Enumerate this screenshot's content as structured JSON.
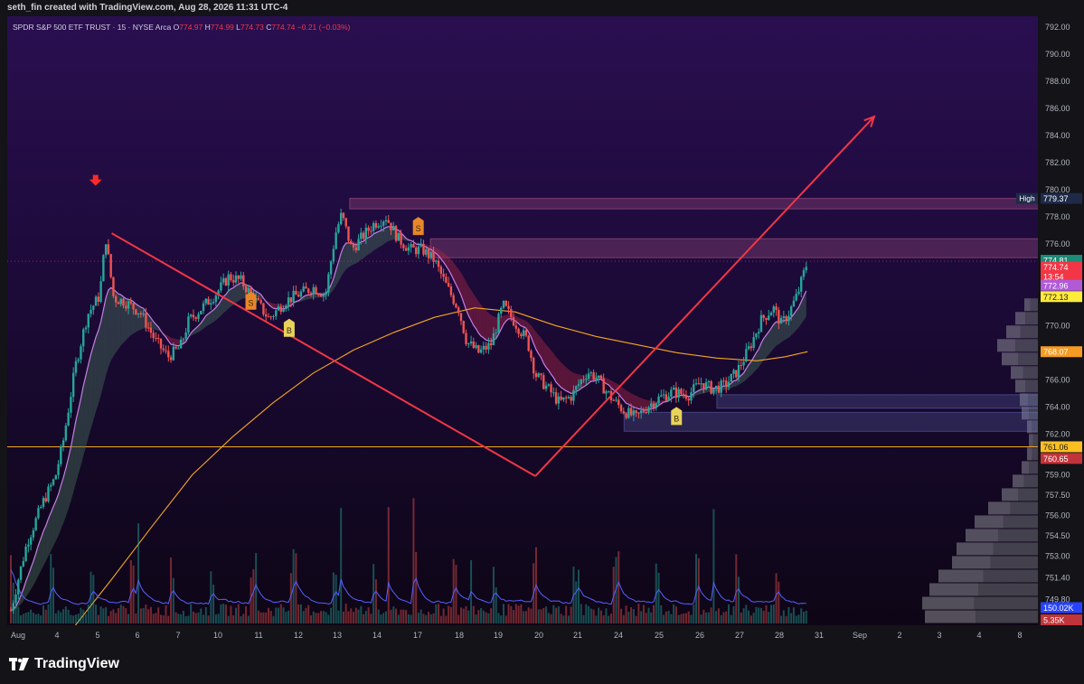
{
  "header": {
    "credit": "seth_fin created with TradingView.com, Aug 28, 2026 11:31 UTC-4"
  },
  "legend": {
    "symbol": "SPDR S&P 500 ETF TRUST · 15 · NYSE Arca",
    "o_label": "O",
    "o_value": "774.97",
    "h_label": "H",
    "h_value": "774.99",
    "l_label": "L",
    "l_value": "774.73",
    "c_label": "C",
    "c_value": "774.74",
    "change": "−0.21 (−0.03%)"
  },
  "footer": {
    "brand": "TradingView"
  },
  "colors": {
    "up": "#26a69a",
    "down": "#ef5350",
    "arrow": "#f23645",
    "ma_slow": "#f5a623",
    "ma_fast": "#c67ee6",
    "volume_ma": "#5560ff",
    "background": "#131318"
  },
  "chart_data": {
    "type": "candlestick",
    "interval": "15",
    "y_axis": {
      "range": [
        747.9,
        792.8
      ],
      "ticks": [
        "792.00",
        "790.00",
        "788.00",
        "786.00",
        "784.00",
        "782.00",
        "780.00",
        "778.00",
        "776.00",
        "770.00",
        "766.00",
        "764.00",
        "762.00",
        "759.00",
        "757.50",
        "756.00",
        "754.50",
        "753.00",
        "751.40",
        "749.80"
      ]
    },
    "x_axis": {
      "ticks": [
        "Aug",
        "4",
        "5",
        "6",
        "7",
        "10",
        "11",
        "12",
        "13",
        "14",
        "17",
        "18",
        "19",
        "20",
        "21",
        "24",
        "25",
        "26",
        "27",
        "28",
        "31",
        "Sep",
        "2",
        "3",
        "4",
        "8"
      ]
    },
    "price_labels": [
      {
        "text": "High",
        "value": "779.37",
        "price": 779.37,
        "color": "#1e2a48"
      },
      {
        "text": "",
        "value": "774.81",
        "price": 774.81,
        "color": "#1e8a78"
      },
      {
        "text": "",
        "value": "774.74",
        "price": 774.3,
        "color": "#f23645"
      },
      {
        "text": "",
        "value": "13:54",
        "price": 773.6,
        "color": "#f23645"
      },
      {
        "text": "",
        "value": "772.96",
        "price": 772.96,
        "color": "#b05ad8"
      },
      {
        "text": "",
        "value": "772.13",
        "price": 772.13,
        "color": "#ffeb3b",
        "dark": true
      },
      {
        "text": "",
        "value": "768.07",
        "price": 768.07,
        "color": "#f59b23"
      },
      {
        "text": "",
        "value": "761.06",
        "price": 761.06,
        "color": "#fbbf24",
        "dark": true
      },
      {
        "text": "",
        "value": "760.65",
        "price": 760.2,
        "color": "#c2343b"
      },
      {
        "text": "",
        "value": "150.02K",
        "price": 749.2,
        "color": "#2843ff"
      },
      {
        "text": "",
        "value": "5.35K",
        "price": 748.3,
        "color": "#c2343b"
      }
    ],
    "signals": [
      {
        "label": "S",
        "day": 5.95,
        "price": 771.7,
        "type": "sell"
      },
      {
        "label": "B",
        "day": 6.9,
        "price": 769.7,
        "type": "buy"
      },
      {
        "label": "S",
        "day": 10.1,
        "price": 777.2,
        "type": "sell"
      },
      {
        "label": "B",
        "day": 16.5,
        "price": 763.2,
        "type": "buy"
      }
    ],
    "red_arrow": {
      "day": 2.1,
      "price": 780.5
    },
    "trendlines": [
      {
        "from": [
          2.5,
          776.8
        ],
        "to": [
          13.0,
          758.9
        ]
      },
      {
        "from": [
          13.0,
          758.9
        ],
        "to": [
          21.4,
          785.4
        ]
      }
    ],
    "horizontal_line": {
      "price": 761.06
    },
    "zones": [
      {
        "from_day": 8.4,
        "to_day": 25.5,
        "low": 778.6,
        "high": 779.37,
        "type": "supply"
      },
      {
        "from_day": 10.4,
        "to_day": 25.5,
        "low": 775.0,
        "high": 776.4,
        "type": "supply"
      },
      {
        "from_day": 17.5,
        "to_day": 25.5,
        "low": 763.9,
        "high": 764.9,
        "type": "demand"
      },
      {
        "from_day": 15.2,
        "to_day": 25.5,
        "low": 762.2,
        "high": 763.6,
        "type": "demand"
      }
    ],
    "closes": [
      {
        "day": 0.0,
        "price": 749.0
      },
      {
        "day": 0.4,
        "price": 754.0
      },
      {
        "day": 0.8,
        "price": 757.0
      },
      {
        "day": 1.1,
        "price": 758.8
      },
      {
        "day": 1.3,
        "price": 761.5
      },
      {
        "day": 1.6,
        "price": 767.0
      },
      {
        "day": 1.9,
        "price": 770.8
      },
      {
        "day": 2.2,
        "price": 772.2
      },
      {
        "day": 2.35,
        "price": 776.5
      },
      {
        "day": 2.55,
        "price": 772.0
      },
      {
        "day": 2.8,
        "price": 771.8
      },
      {
        "day": 3.2,
        "price": 771.0
      },
      {
        "day": 3.6,
        "price": 768.8
      },
      {
        "day": 3.9,
        "price": 767.7
      },
      {
        "day": 4.2,
        "price": 768.4
      },
      {
        "day": 4.4,
        "price": 770.3
      },
      {
        "day": 4.8,
        "price": 771.5
      },
      {
        "day": 5.1,
        "price": 772.4
      },
      {
        "day": 5.4,
        "price": 773.6
      },
      {
        "day": 5.7,
        "price": 773.3
      },
      {
        "day": 6.0,
        "price": 772.1
      },
      {
        "day": 6.4,
        "price": 770.5
      },
      {
        "day": 6.8,
        "price": 771.8
      },
      {
        "day": 7.2,
        "price": 772.4
      },
      {
        "day": 7.5,
        "price": 772.8
      },
      {
        "day": 7.8,
        "price": 772.3
      },
      {
        "day": 8.05,
        "price": 776.8
      },
      {
        "day": 8.2,
        "price": 778.2
      },
      {
        "day": 8.45,
        "price": 775.6
      },
      {
        "day": 8.7,
        "price": 776.5
      },
      {
        "day": 9.0,
        "price": 777.5
      },
      {
        "day": 9.3,
        "price": 778.0
      },
      {
        "day": 9.6,
        "price": 776.4
      },
      {
        "day": 9.9,
        "price": 775.6
      },
      {
        "day": 10.2,
        "price": 775.6
      },
      {
        "day": 10.5,
        "price": 774.8
      },
      {
        "day": 10.8,
        "price": 772.9
      },
      {
        "day": 11.1,
        "price": 771.2
      },
      {
        "day": 11.3,
        "price": 768.8
      },
      {
        "day": 11.6,
        "price": 768.0
      },
      {
        "day": 11.9,
        "price": 768.6
      },
      {
        "day": 12.2,
        "price": 771.5
      },
      {
        "day": 12.5,
        "price": 770.2
      },
      {
        "day": 12.8,
        "price": 768.9
      },
      {
        "day": 13.0,
        "price": 766.4
      },
      {
        "day": 13.3,
        "price": 765.4
      },
      {
        "day": 13.6,
        "price": 764.3
      },
      {
        "day": 13.9,
        "price": 764.8
      },
      {
        "day": 14.1,
        "price": 765.8
      },
      {
        "day": 14.3,
        "price": 766.6
      },
      {
        "day": 14.5,
        "price": 766.2
      },
      {
        "day": 14.9,
        "price": 764.6
      },
      {
        "day": 15.2,
        "price": 763.7
      },
      {
        "day": 15.5,
        "price": 763.2
      },
      {
        "day": 15.8,
        "price": 764.1
      },
      {
        "day": 16.1,
        "price": 764.7
      },
      {
        "day": 16.4,
        "price": 765.1
      },
      {
        "day": 16.8,
        "price": 764.9
      },
      {
        "day": 17.1,
        "price": 765.8
      },
      {
        "day": 17.4,
        "price": 765.3
      },
      {
        "day": 17.7,
        "price": 765.6
      },
      {
        "day": 18.0,
        "price": 766.6
      },
      {
        "day": 18.3,
        "price": 768.3
      },
      {
        "day": 18.6,
        "price": 770.4
      },
      {
        "day": 18.9,
        "price": 771.3
      },
      {
        "day": 19.1,
        "price": 770.1
      },
      {
        "day": 19.3,
        "price": 771.0
      },
      {
        "day": 19.5,
        "price": 772.3
      },
      {
        "day": 19.7,
        "price": 774.3
      },
      {
        "day": 19.75,
        "price": 774.74
      }
    ],
    "ma_slow": [
      {
        "day": 1.6,
        "price": 747.9
      },
      {
        "day": 2.5,
        "price": 751.3
      },
      {
        "day": 3.5,
        "price": 755.2
      },
      {
        "day": 4.5,
        "price": 759.0
      },
      {
        "day": 5.5,
        "price": 761.8
      },
      {
        "day": 6.5,
        "price": 764.3
      },
      {
        "day": 7.5,
        "price": 766.5
      },
      {
        "day": 8.5,
        "price": 768.2
      },
      {
        "day": 9.5,
        "price": 769.5
      },
      {
        "day": 10.5,
        "price": 770.6
      },
      {
        "day": 11.5,
        "price": 771.3
      },
      {
        "day": 12.5,
        "price": 771.0
      },
      {
        "day": 13.5,
        "price": 770.0
      },
      {
        "day": 14.5,
        "price": 769.2
      },
      {
        "day": 15.5,
        "price": 768.6
      },
      {
        "day": 16.5,
        "price": 768.0
      },
      {
        "day": 17.5,
        "price": 767.6
      },
      {
        "day": 18.5,
        "price": 767.4
      },
      {
        "day": 19.2,
        "price": 767.7
      },
      {
        "day": 19.75,
        "price": 768.07
      }
    ],
    "volume": {
      "ma_last": "150.02K",
      "last": "5.35K"
    }
  }
}
